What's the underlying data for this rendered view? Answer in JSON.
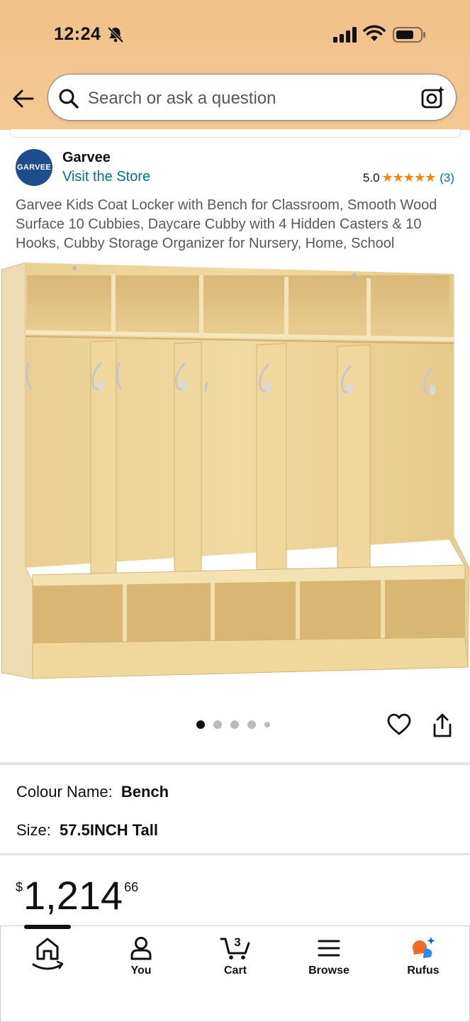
{
  "status_bar": {
    "time": "12:24",
    "icons": [
      "bell-slash-icon",
      "signal-icon",
      "wifi-icon",
      "battery-icon"
    ]
  },
  "search": {
    "placeholder": "Search or ask a question"
  },
  "store": {
    "logo_text": "GARVEE",
    "name": "Garvee",
    "visit_link": "Visit the Store",
    "rating": "5.0",
    "stars": "★★★★★",
    "review_count": "(3)"
  },
  "product": {
    "title": "Garvee Kids Coat Locker with Bench for Classroom, Smooth Wood Surface 10 Cubbies, Daycare Cubby with 4 Hidden Casters & 10 Hooks, Cubby Storage Organizer for Nursery, Home, School",
    "image_count": 5,
    "active_image": 1
  },
  "variants": {
    "colour_label": "Colour Name:",
    "colour_value": "Bench",
    "size_label": "Size:",
    "size_value": "57.5INCH Tall"
  },
  "price": {
    "symbol": "$",
    "whole": "1,214",
    "fraction": "66"
  },
  "bottom_nav": {
    "items": [
      {
        "label": "",
        "icon": "home-icon"
      },
      {
        "label": "You",
        "icon": "user-icon"
      },
      {
        "label": "Cart",
        "icon": "cart-icon",
        "count": "3"
      },
      {
        "label": "Browse",
        "icon": "menu-icon"
      },
      {
        "label": "Rufus",
        "icon": "rufus-icon"
      }
    ]
  },
  "colors": {
    "header": "#f3c590",
    "link": "#007185",
    "star": "#f08804",
    "logo_bg": "#1f4d8c"
  }
}
